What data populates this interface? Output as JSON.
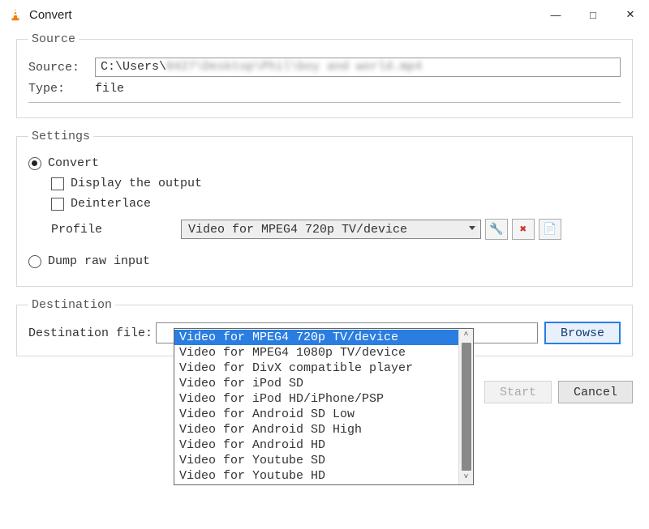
{
  "window": {
    "title": "Convert"
  },
  "winbuttons": {
    "min": "—",
    "max": "□",
    "close": "✕"
  },
  "source": {
    "legend": "Source",
    "source_label": "Source:",
    "source_value": "C:\\Users\\0427\\Desktop\\Phil\\boy and world.mp4",
    "type_label": "Type:",
    "type_value": "file"
  },
  "settings": {
    "legend": "Settings",
    "convert_label": "Convert",
    "display_output_label": "Display the output",
    "deinterlace_label": "Deinterlace",
    "profile_label": "Profile",
    "profile_selected": "Video for MPEG4 720p TV/device",
    "dump_raw_label": "Dump raw input",
    "profile_options": [
      "Video for MPEG4 720p TV/device",
      "Video for MPEG4 1080p TV/device",
      "Video for DivX compatible player",
      "Video for iPod SD",
      "Video for iPod HD/iPhone/PSP",
      "Video for Android SD Low",
      "Video for Android SD High",
      "Video for Android HD",
      "Video for Youtube SD",
      "Video for Youtube HD"
    ]
  },
  "icons": {
    "wrench": "🔧",
    "delete": "✖",
    "new": "📄"
  },
  "destination": {
    "legend": "Destination",
    "file_label": "Destination file:",
    "browse_label": "Browse"
  },
  "footer": {
    "start": "Start",
    "cancel": "Cancel"
  }
}
